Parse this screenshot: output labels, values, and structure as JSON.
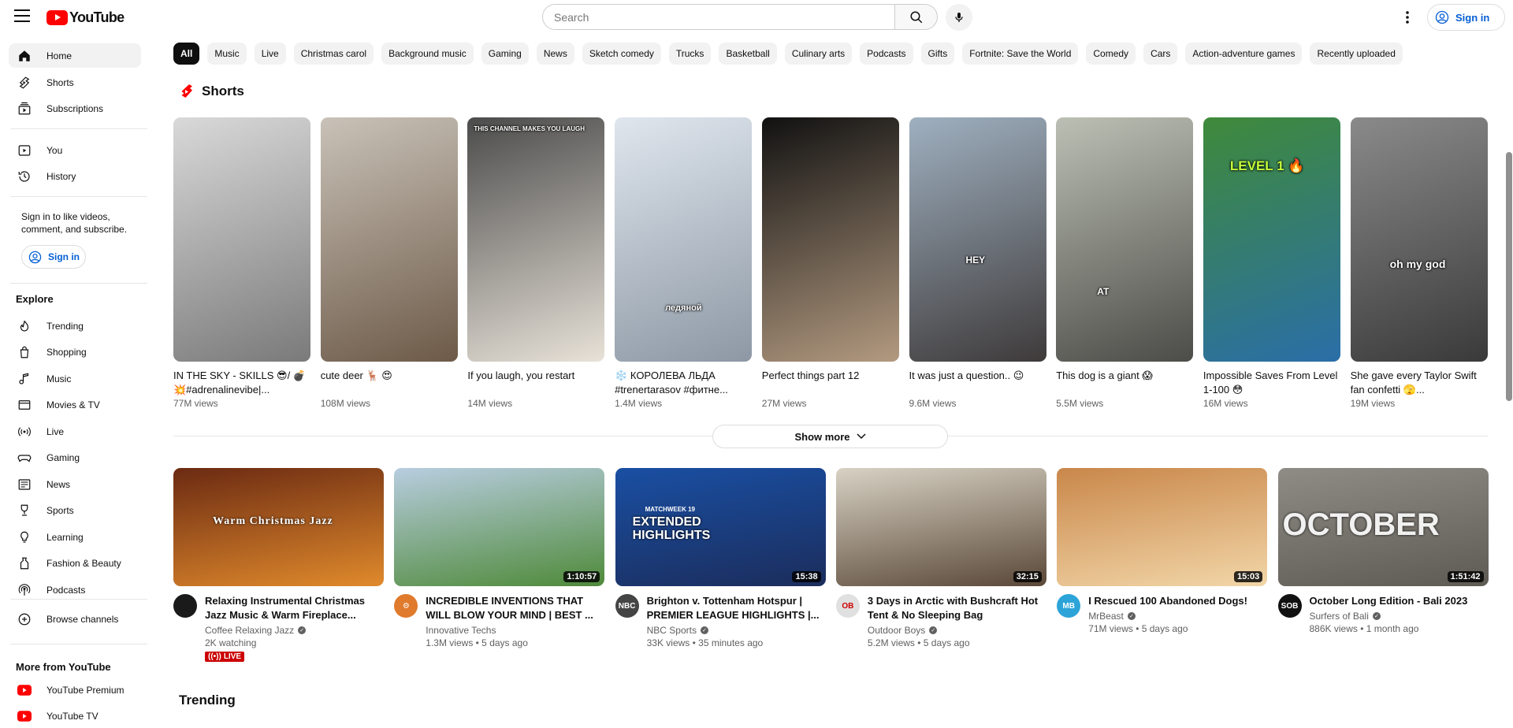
{
  "topbar": {
    "logo_text": "YouTube",
    "search_placeholder": "Search",
    "sign_in": "Sign in"
  },
  "sidebar": {
    "primary": [
      {
        "label": "Home",
        "icon": "home-icon",
        "active": true
      },
      {
        "label": "Shorts",
        "icon": "shorts-icon"
      },
      {
        "label": "Subscriptions",
        "icon": "subscriptions-icon"
      }
    ],
    "secondary": [
      {
        "label": "You",
        "icon": "you-icon"
      },
      {
        "label": "History",
        "icon": "history-icon"
      }
    ],
    "signin_note": "Sign in to like videos, comment, and subscribe.",
    "signin_button": "Sign in",
    "explore_title": "Explore",
    "explore": [
      {
        "label": "Trending",
        "icon": "trending-icon"
      },
      {
        "label": "Shopping",
        "icon": "shopping-icon"
      },
      {
        "label": "Music",
        "icon": "music-icon"
      },
      {
        "label": "Movies & TV",
        "icon": "movies-icon"
      },
      {
        "label": "Live",
        "icon": "live-icon"
      },
      {
        "label": "Gaming",
        "icon": "gaming-icon"
      },
      {
        "label": "News",
        "icon": "news-icon"
      },
      {
        "label": "Sports",
        "icon": "sports-icon"
      },
      {
        "label": "Learning",
        "icon": "learning-icon"
      },
      {
        "label": "Fashion & Beauty",
        "icon": "fashion-icon"
      },
      {
        "label": "Podcasts",
        "icon": "podcasts-icon"
      }
    ],
    "browse_channels": "Browse channels",
    "more_title": "More from YouTube",
    "more": [
      {
        "label": "YouTube Premium",
        "icon": "youtube-premium-icon"
      },
      {
        "label": "YouTube TV",
        "icon": "youtube-tv-icon"
      }
    ]
  },
  "chips": [
    "All",
    "Music",
    "Live",
    "Christmas carol",
    "Background music",
    "Gaming",
    "News",
    "Sketch comedy",
    "Trucks",
    "Basketball",
    "Culinary arts",
    "Podcasts",
    "Gifts",
    "Fortnite: Save the World",
    "Comedy",
    "Cars",
    "Action-adventure games",
    "Recently uploaded"
  ],
  "shorts": {
    "title": "Shorts",
    "items": [
      {
        "title": "IN THE SKY - SKILLS 😎/ 💣💥#adrenalinevibe|...",
        "views": "77M views",
        "colors": [
          "#d9d9d9",
          "#7a7a7a"
        ]
      },
      {
        "title": "cute deer 🦌 😍",
        "views": "108M views",
        "colors": [
          "#c9c2b8",
          "#6d5a48"
        ]
      },
      {
        "title": "If you laugh, you restart",
        "views": "14M views",
        "overlay": "THIS CHANNEL MAKES YOU LAUGH",
        "colors": [
          "#4b4b4b",
          "#e8e2d8"
        ]
      },
      {
        "title": "❄️ КОРОЛЕВА ЛЬДА #trenertarasov #фитне...",
        "views": "1.4M views",
        "overlay": "ледяной",
        "colors": [
          "#dfe6ee",
          "#8d98a4"
        ]
      },
      {
        "title": "Perfect things part 12",
        "views": "27M views",
        "colors": [
          "#111111",
          "#b39a80"
        ]
      },
      {
        "title": "It was just a question.. 😉",
        "views": "9.6M views",
        "overlay": "HEY",
        "colors": [
          "#9fb0c0",
          "#3e3a3a"
        ]
      },
      {
        "title": "This dog is a giant 😱",
        "views": "5.5M views",
        "overlay": "AT",
        "colors": [
          "#bcc0b4",
          "#4c4c48"
        ]
      },
      {
        "title": "Impossible Saves From Level 1-100 😳",
        "views": "16M views",
        "overlay": "LEVEL 1 🔥",
        "colors": [
          "#3f8a3a",
          "#2a6ea8"
        ]
      },
      {
        "title": "She gave every Taylor Swift fan confetti 🫣...",
        "views": "19M views",
        "overlay": "oh my god",
        "colors": [
          "#8a8a8a",
          "#3a3a3a"
        ]
      }
    ],
    "show_more": "Show more"
  },
  "videos": [
    {
      "title": "Relaxing Instrumental Christmas Jazz Music & Warm Fireplace...",
      "channel": "Coffee Relaxing Jazz",
      "verified": true,
      "stats": "2K watching",
      "live": "LIVE",
      "thumb_text": "Warm Christmas Jazz",
      "colors": [
        "#6b2a12",
        "#e08a2c"
      ],
      "avatar_color": "#1a1a1a",
      "avatar_text": ""
    },
    {
      "title": "INCREDIBLE INVENTIONS THAT WILL BLOW YOUR MIND | BEST ...",
      "channel": "Innovative Techs",
      "verified": false,
      "stats": "1.3M views • 5 days ago",
      "duration": "1:10:57",
      "colors": [
        "#b8cde0",
        "#4f8a3a"
      ],
      "avatar_color": "#e07a2c",
      "avatar_text": "⚙"
    },
    {
      "title": "Brighton v. Tottenham Hotspur | PREMIER LEAGUE HIGHLIGHTS |...",
      "channel": "NBC Sports",
      "verified": true,
      "stats": "33K views • 35 minutes ago",
      "duration": "15:38",
      "thumb_text": "EXTENDED HIGHLIGHTS",
      "thumb_sub": "MATCHWEEK 19",
      "colors": [
        "#1a4fa3",
        "#1b2d5c"
      ],
      "avatar_color": "#444444",
      "avatar_text": "NBC"
    },
    {
      "title": "3 Days in Arctic with Bushcraft Hot Tent & No Sleeping Bag",
      "channel": "Outdoor Boys",
      "verified": true,
      "stats": "5.2M views • 5 days ago",
      "duration": "32:15",
      "colors": [
        "#d8d2c4",
        "#5a4838"
      ],
      "avatar_color": "#e0e0e0",
      "avatar_text": "OB"
    },
    {
      "title": "I Rescued 100 Abandoned Dogs!",
      "channel": "MrBeast",
      "verified": true,
      "stats": "71M views • 5 days ago",
      "duration": "15:03",
      "colors": [
        "#c9874a",
        "#f2d6a8"
      ],
      "avatar_color": "#2ca4d8",
      "avatar_text": "MB"
    },
    {
      "title": "October Long Edition - Bali 2023",
      "channel": "Surfers of Bali",
      "verified": true,
      "stats": "886K views • 1 month ago",
      "duration": "1:51:42",
      "thumb_text": "OCTOBER",
      "colors": [
        "#8f8c86",
        "#5e5a54"
      ],
      "avatar_color": "#111111",
      "avatar_text": "SOB"
    }
  ],
  "trending_title": "Trending"
}
